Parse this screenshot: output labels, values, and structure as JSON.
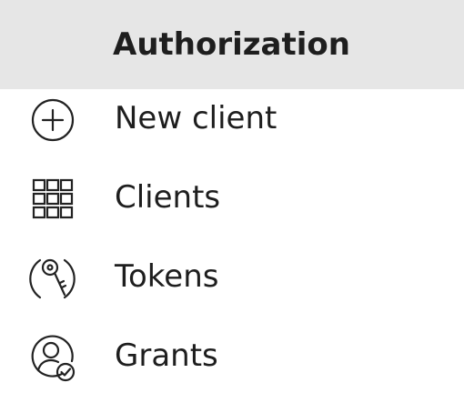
{
  "header": {
    "title": "Authorization"
  },
  "menu": {
    "items": [
      {
        "label": "New client",
        "icon": "add-circle-icon"
      },
      {
        "label": "Clients",
        "icon": "grid-icon"
      },
      {
        "label": "Tokens",
        "icon": "key-icon"
      },
      {
        "label": "Grants",
        "icon": "person-check-icon"
      }
    ]
  },
  "colors": {
    "header_background": "#e6e6e6",
    "text": "#1e1e1e",
    "icon_stroke": "#222222"
  }
}
